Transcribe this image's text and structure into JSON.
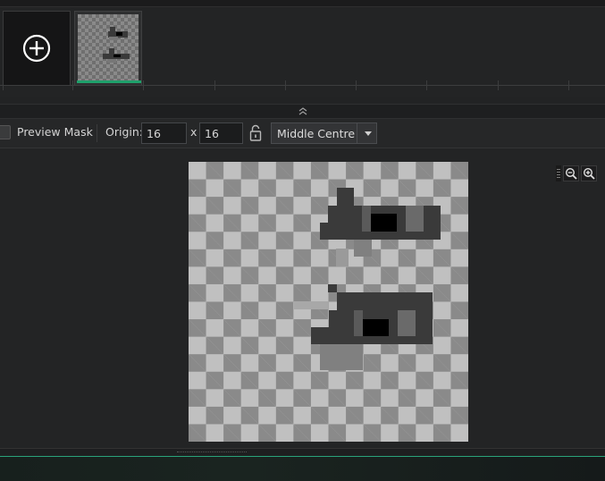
{
  "frames": {
    "add_frame_icon": "plus-circle-icon",
    "selected_index": 0,
    "accent": "#1fa06b"
  },
  "collapse": {
    "icon": "double-chevron-up-icon"
  },
  "toolbar": {
    "preview_mask_label": "Preview Mask",
    "preview_mask_checked": false,
    "origin_label": "Origin:",
    "origin_x": "16",
    "x_sep": "x",
    "origin_y": "16",
    "lock_icon": "unlocked-padlock-icon",
    "origin_preset": "Middle Centre"
  },
  "canvas": {
    "zoom_out_icon": "zoom-out-icon",
    "zoom_in_icon": "zoom-in-icon"
  }
}
